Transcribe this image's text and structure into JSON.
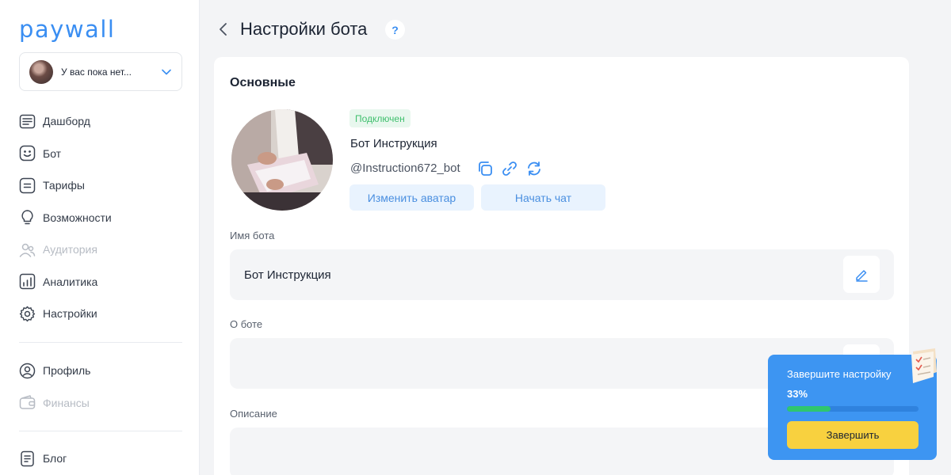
{
  "app": {
    "logo": "paywall"
  },
  "account": {
    "label": "У вас пока нет..."
  },
  "sidebar": {
    "items": [
      {
        "label": "Дашборд",
        "icon": "dashboard-icon",
        "disabled": false
      },
      {
        "label": "Бот",
        "icon": "bot-icon",
        "disabled": false
      },
      {
        "label": "Тарифы",
        "icon": "tariffs-icon",
        "disabled": false
      },
      {
        "label": "Возможности",
        "icon": "lightbulb-icon",
        "disabled": false
      },
      {
        "label": "Аудитория",
        "icon": "audience-icon",
        "disabled": true
      },
      {
        "label": "Аналитика",
        "icon": "analytics-icon",
        "disabled": false
      },
      {
        "label": "Настройки",
        "icon": "gear-icon",
        "disabled": false
      },
      {
        "label": "Профиль",
        "icon": "profile-icon",
        "disabled": false
      },
      {
        "label": "Финансы",
        "icon": "wallet-icon",
        "disabled": true
      },
      {
        "label": "Блог",
        "icon": "blog-icon",
        "disabled": false
      }
    ]
  },
  "header": {
    "title": "Настройки бота",
    "help": "?"
  },
  "main": {
    "section_title": "Основные",
    "status": "Подключен",
    "bot_name": "Бот Инструкция",
    "bot_handle": "@Instruction672_bot",
    "change_avatar": "Изменить аватар",
    "start_chat": "Начать чат",
    "fields": [
      {
        "label": "Имя бота",
        "value": "Бот Инструкция"
      },
      {
        "label": "О боте",
        "value": ""
      },
      {
        "label": "Описание",
        "value": ""
      }
    ]
  },
  "setup": {
    "title": "Завершите настройку",
    "percent_text": "33%",
    "progress": 0.33,
    "button": "Завершить"
  },
  "colors": {
    "accent": "#3a8ef2",
    "success": "#3fbf6d",
    "warning": "#f8d13f"
  }
}
